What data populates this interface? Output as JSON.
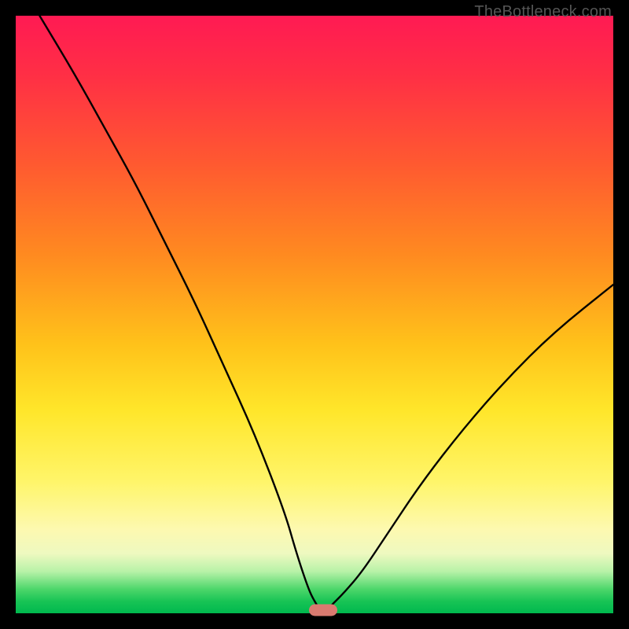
{
  "attribution": "TheBottleneck.com",
  "chart_data": {
    "type": "line",
    "title": "",
    "xlabel": "",
    "ylabel": "",
    "xlim": [
      0,
      100
    ],
    "ylim": [
      0,
      100
    ],
    "series": [
      {
        "name": "bottleneck-curve",
        "x": [
          4,
          10,
          15,
          20,
          25,
          30,
          35,
          40,
          45,
          47,
          49,
          50,
          51,
          52,
          53,
          55,
          58,
          62,
          68,
          75,
          82,
          90,
          100
        ],
        "y": [
          100,
          90,
          81,
          72,
          62,
          52,
          41,
          30,
          17,
          10,
          4,
          2,
          0.5,
          0.5,
          1.5,
          3.5,
          7,
          13,
          22,
          31,
          39,
          47,
          55
        ]
      }
    ],
    "marker": {
      "x": 51.5,
      "y": 0.5
    },
    "gradient_stops": [
      {
        "pos": 0,
        "color": "#ff1a53"
      },
      {
        "pos": 10,
        "color": "#ff2f45"
      },
      {
        "pos": 25,
        "color": "#ff5a30"
      },
      {
        "pos": 40,
        "color": "#ff8a20"
      },
      {
        "pos": 55,
        "color": "#ffc21a"
      },
      {
        "pos": 66,
        "color": "#ffe62a"
      },
      {
        "pos": 78,
        "color": "#fff56a"
      },
      {
        "pos": 86,
        "color": "#fdf9b0"
      },
      {
        "pos": 90,
        "color": "#eef9c0"
      },
      {
        "pos": 93,
        "color": "#b8f2a8"
      },
      {
        "pos": 96,
        "color": "#4cd66a"
      },
      {
        "pos": 98,
        "color": "#18c455"
      },
      {
        "pos": 100,
        "color": "#00b84e"
      }
    ]
  }
}
